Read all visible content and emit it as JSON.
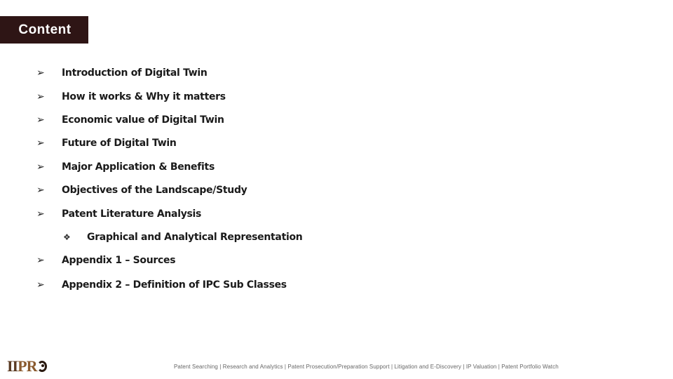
{
  "header": {
    "title": "Content"
  },
  "toc": {
    "items": [
      {
        "label": "Introduction of Digital Twin",
        "bullet_icon": "arrowhead-bullet-icon",
        "bullet": "➢"
      },
      {
        "label": "How it works & Why it matters",
        "bullet_icon": "arrowhead-bullet-icon",
        "bullet": "➢"
      },
      {
        "label": "Economic value of Digital Twin",
        "bullet_icon": "arrowhead-bullet-icon",
        "bullet": "➢"
      },
      {
        "label": "Future of Digital Twin",
        "bullet_icon": "arrowhead-bullet-icon",
        "bullet": "➢"
      },
      {
        "label": "Major Application & Benefits",
        "bullet_icon": "arrowhead-bullet-icon",
        "bullet": "➢"
      },
      {
        "label": "Objectives of the Landscape/Study",
        "bullet_icon": "arrowhead-bullet-icon",
        "bullet": "➢"
      },
      {
        "label": "Patent Literature Analysis",
        "bullet_icon": "arrowhead-bullet-icon",
        "bullet": "➢"
      },
      {
        "label": "Graphical and Analytical Representation",
        "bullet_icon": "diamond-bullet-icon",
        "bullet": "❖",
        "sub": true
      },
      {
        "label": "Appendix 1 – Sources",
        "bullet_icon": "arrowhead-bullet-icon",
        "bullet": "➢"
      },
      {
        "label": "Appendix 2 – Definition of IPC Sub Classes",
        "bullet_icon": "arrowhead-bullet-icon",
        "bullet": "➢"
      }
    ]
  },
  "footer": {
    "logo_text_dark": "II",
    "logo_text_brown": "PR",
    "services": "Patent Searching | Research and Analytics | Patent Prosecution/Preparation Support | Litigation and E-Discovery | IP Valuation | Patent Portfolio Watch"
  },
  "colors": {
    "title_bg": "#2e1515",
    "title_text": "#ffffff",
    "logo_dark": "#5a3a22",
    "logo_brown": "#8a5a2e"
  }
}
